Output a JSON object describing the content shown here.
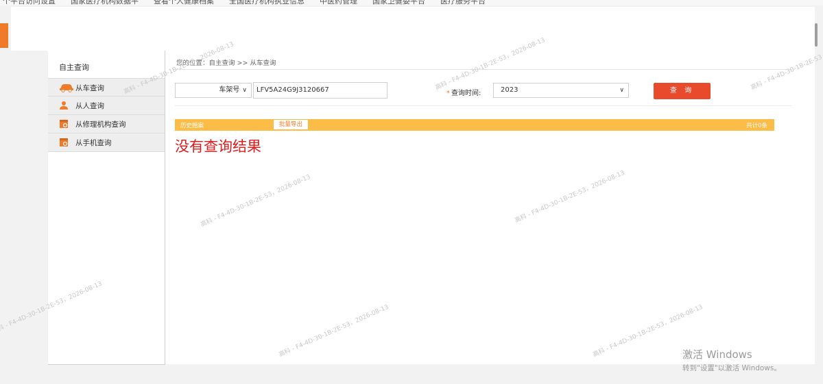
{
  "bookmarks": [
    "个平台访问设置",
    "国家医疗机构数据平",
    "查看个人健康档案",
    "全国医疗机构执业信息",
    "中医药管理",
    "国家卫健委平台",
    "医疗服务平台"
  ],
  "sidebar": {
    "title": "自主查询",
    "items": [
      {
        "label": "从车查询",
        "icon": "car-icon"
      },
      {
        "label": "从人查询",
        "icon": "person-icon"
      },
      {
        "label": "从修理机构查询",
        "icon": "repair-shop-icon"
      },
      {
        "label": "从手机查询",
        "icon": "phone-icon"
      }
    ]
  },
  "breadcrumb": "您的位置：自主查询 >> 从车查询",
  "search": {
    "field_type": "车架号",
    "vin_value": "LFV5A24G9J3120667",
    "time_label": "查询时间:",
    "time_required_mark": "*",
    "year_value": "2023",
    "query_button": "查 询"
  },
  "history": {
    "label": "历史赔案",
    "export_button": "批量导出",
    "total": "共计0条"
  },
  "no_result": "没有查询结果",
  "watermark": "高科 - F4-4D-30-1B-2E-53，2026-08-13",
  "activation": {
    "title": "激活 Windows",
    "subtitle": "转到\"设置\"以激活 Windows。"
  },
  "colors": {
    "accent_orange": "#ef7b2a",
    "query_button": "#e84a2c",
    "history_bar": "#fbbd48",
    "no_result_text": "#e01c1c"
  }
}
